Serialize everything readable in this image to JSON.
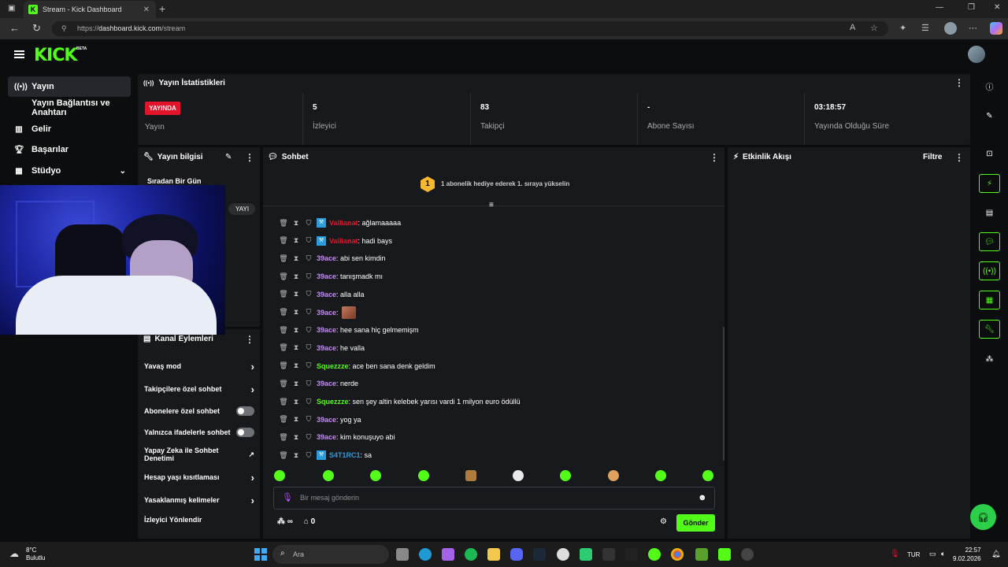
{
  "browser": {
    "tab_title": "Stream - Kick Dashboard",
    "url_prefix": "https://",
    "url_host": "dashboard.kick.com",
    "url_path": "/stream"
  },
  "header": {
    "logo": "KICK",
    "logo_badge": "BETA"
  },
  "sidebar": {
    "items": [
      {
        "label": "Yayın",
        "icon": "broadcast-icon"
      },
      {
        "label": "Yayın Bağlantısı ve Anahtarı"
      },
      {
        "label": "Gelir",
        "icon": "chart-icon"
      },
      {
        "label": "Başarılar",
        "icon": "trophy-icon"
      },
      {
        "label": "Stüdyo",
        "icon": "studio-icon"
      }
    ]
  },
  "stats": {
    "title": "Yayın İstatistikleri",
    "live_badge": "YAYINDA",
    "live_label": "Yayın",
    "viewers_value": "5",
    "viewers_label": "İzleyici",
    "followers_value": "83",
    "followers_label": "Takipçi",
    "subs_value": "-",
    "subs_label": "Abone Sayısı",
    "duration_value": "03:18:57",
    "duration_label": "Yayında Olduğu Süre"
  },
  "stream_info": {
    "title": "Yayın bilgisi",
    "stream_title": "Sıradan Bir Gün",
    "tag": "YAYI"
  },
  "channel_actions": {
    "title": "Kanal Eylemleri",
    "items": [
      {
        "label": "Yavaş mod"
      },
      {
        "label": "Takipçilere özel sohbet"
      },
      {
        "label": "Abonelere özel sohbet"
      },
      {
        "label": "Yalnızca ifadelerle sohbet"
      },
      {
        "label": "Yapay Zeka ile Sohbet Denetimi"
      },
      {
        "label": "Hesap yaşı kısıtlaması"
      },
      {
        "label": "Yasaklanmış kelimeler"
      },
      {
        "label": "İzleyici Yönlendir"
      }
    ]
  },
  "chat": {
    "title": "Sohbet",
    "promo_rank": "1",
    "promo_text": "1 abonelik hediye ederek 1. sıraya yükselin",
    "messages": [
      {
        "user": "Vallianat",
        "text": ": ağlamaaaaa",
        "color": "#e3132b",
        "badge": true
      },
      {
        "user": "Vallianat",
        "text": ": hadi bays",
        "color": "#e3132b",
        "badge": true
      },
      {
        "user": "39ace",
        "text": ": abi sen kimdin",
        "color": "#c58af9",
        "badge": false
      },
      {
        "user": "39ace",
        "text": ": tanışmadk mı",
        "color": "#c58af9",
        "badge": false
      },
      {
        "user": "39ace",
        "text": ": alla alla",
        "color": "#c58af9",
        "badge": false
      },
      {
        "user": "39ace",
        "text": ":",
        "color": "#c58af9",
        "badge": false,
        "emote": true
      },
      {
        "user": "39ace",
        "text": ": hee sana hiç gelmemişm",
        "color": "#c58af9",
        "badge": false
      },
      {
        "user": "39ace",
        "text": ": he valla",
        "color": "#c58af9",
        "badge": false
      },
      {
        "user": "Squezzze",
        "text": ": ace ben sana denk geldim",
        "color": "#53fc18",
        "badge": false
      },
      {
        "user": "39ace",
        "text": ": nerde",
        "color": "#c58af9",
        "badge": false
      },
      {
        "user": "Squezzze",
        "text": ": sen şey altin kelebek yarısı vardi 1 milyon euro ödüllü",
        "color": "#53fc18",
        "badge": false
      },
      {
        "user": "39ace",
        "text": ": yog ya",
        "color": "#c58af9",
        "badge": false
      },
      {
        "user": "39ace",
        "text": ": kim konuşuyo abi",
        "color": "#c58af9",
        "badge": false
      },
      {
        "user": "S4T1RC1",
        "text": ": sa",
        "color": "#2d9cdb",
        "badge": true
      }
    ],
    "input_placeholder": "Bir mesaj gönderin",
    "points": "∞",
    "store_count": "0",
    "send_label": "Gönder"
  },
  "events": {
    "title": "Etkinlik Akışı",
    "filter_label": "Filtre"
  },
  "taskbar": {
    "temperature": "8°C",
    "weather": "Bulutlu",
    "search": "Ara",
    "lang": "TUR",
    "time": "22:57",
    "date": "9.02.2026"
  },
  "colors": {
    "accent": "#53fc18",
    "live": "#e3132b",
    "panel": "#18191c"
  }
}
